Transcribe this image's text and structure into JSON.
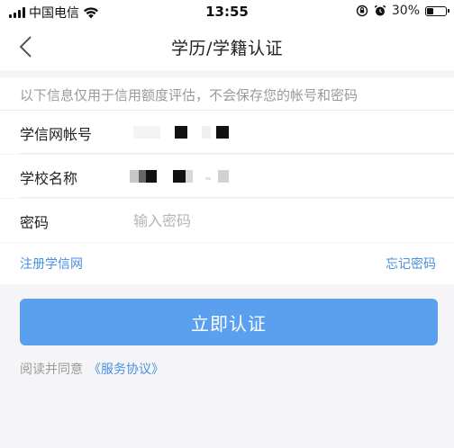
{
  "status_bar": {
    "carrier": "中国电信",
    "time": "13:55",
    "battery_percent": "30%",
    "battery_level": 0.3,
    "icons": [
      "signal-icon",
      "wifi-icon",
      "lock-rotation-icon",
      "alarm-icon",
      "battery-icon"
    ]
  },
  "nav": {
    "back_icon": "chevron-left-icon",
    "title": "学历/学籍认证"
  },
  "notice": {
    "text": "以下信息仅用于信用额度评估，不会保存您的帐号和密码"
  },
  "form": {
    "account": {
      "label": "学信网帐号",
      "value_masked": true
    },
    "school": {
      "label": "学校名称",
      "value_masked": true
    },
    "password": {
      "label": "密码",
      "placeholder": "输入密码",
      "value": ""
    }
  },
  "links": {
    "register": "注册学信网",
    "forgot": "忘记密码"
  },
  "submit": {
    "label": "立即认证"
  },
  "agreement": {
    "prefix": "阅读并同意",
    "link": "《服务协议》"
  },
  "colors": {
    "accent": "#5aa0ee",
    "link": "#4a8fe0",
    "background": "#f5f5f7",
    "muted_text": "#9a9a9a"
  }
}
